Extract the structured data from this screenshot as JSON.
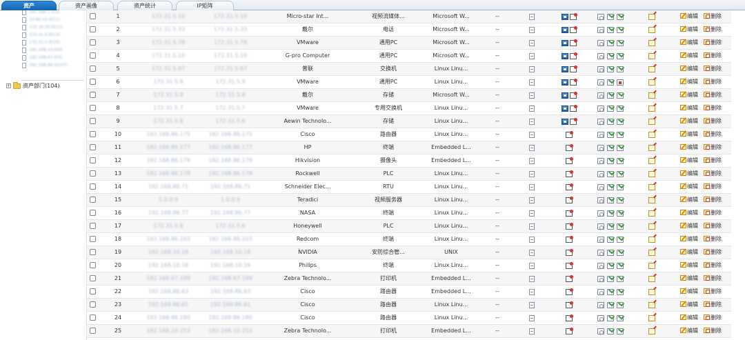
{
  "tabs": [
    {
      "label": "资产",
      "active": true
    },
    {
      "label": "资产画像",
      "active": false
    },
    {
      "label": "资产统计",
      "active": false
    },
    {
      "label": "IP矩阵",
      "active": false
    }
  ],
  "tree": {
    "children": [
      "192.168.1.0(1)",
      "10.90.10.0(11)",
      "172.16.20.0(11)",
      "172.21.0.0(13)",
      "172.21.5.0(10)",
      "192.168.10.0(9)",
      "192.168.67.0(3)",
      "192.168.86.0(107)"
    ],
    "root_label": "资产部门(104)"
  },
  "actions": {
    "edit": "编辑",
    "delete": "删除"
  },
  "rows": [
    {
      "num": "1",
      "ip1": "172.31.5.10",
      "ip2": "172.31.5.10",
      "vendor": "Micro-star Int...",
      "type": "视频流媒体...",
      "os": "Microsoft W...",
      "dash": "--",
      "mon": true
    },
    {
      "num": "2",
      "ip1": "172.31.5.33",
      "ip2": "172.31.5.33",
      "vendor": "戴尔",
      "type": "电话",
      "os": "Microsoft W...",
      "dash": "--",
      "mon": true
    },
    {
      "num": "3",
      "ip1": "172.31.5.78",
      "ip2": "172.31.5.78",
      "vendor": "VMware",
      "type": "通用PC",
      "os": "Microsoft W...",
      "dash": "--",
      "mon": true
    },
    {
      "num": "4",
      "ip1": "172.31.5.10",
      "ip2": "172.31.5.10",
      "vendor": "G-pro Computer",
      "type": "通用PC",
      "os": "Microsoft W...",
      "dash": "--",
      "mon": true
    },
    {
      "num": "5",
      "ip1": "172.31.5.87",
      "ip2": "172.31.5.87",
      "vendor": "普联",
      "type": "交换机",
      "os": "Linux Linu...",
      "dash": "--",
      "mon": true
    },
    {
      "num": "6",
      "ip1": "172.31.5.9",
      "ip2": "172.31.5.9",
      "vendor": "VMware",
      "type": "通用PC",
      "os": "Linux Linu...",
      "dash": "--",
      "mon": true,
      "red": true
    },
    {
      "num": "7",
      "ip1": "172.31.5.8",
      "ip2": "172.31.5.8",
      "vendor": "戴尔",
      "type": "存储",
      "os": "Microsoft W...",
      "dash": "--",
      "mon": true
    },
    {
      "num": "8",
      "ip1": "172.31.5.7",
      "ip2": "172.31.5.7",
      "vendor": "VMware",
      "type": "专用交换机",
      "os": "Linux Linu...",
      "dash": "--",
      "mon": true
    },
    {
      "num": "9",
      "ip1": "172.31.5.6",
      "ip2": "172.31.5.6",
      "vendor": "Aewin Technolo...",
      "type": "存储",
      "os": "Linux Linu...",
      "dash": "--",
      "mon": true
    },
    {
      "num": "10",
      "ip1": "192.168.86.175",
      "ip2": "192.168.86.175",
      "vendor": "Cisco",
      "type": "路由器",
      "os": "Linux Linu...",
      "dash": "--",
      "mon": false
    },
    {
      "num": "11",
      "ip1": "192.168.86.177",
      "ip2": "192.168.86.177",
      "vendor": "HP",
      "type": "终端",
      "os": "Embedded L...",
      "dash": "--",
      "mon": false
    },
    {
      "num": "12",
      "ip1": "192.168.86.179",
      "ip2": "192.168.86.179",
      "vendor": "Hikvision",
      "type": "摄像头",
      "os": "Embedded L...",
      "dash": "--",
      "mon": false
    },
    {
      "num": "13",
      "ip1": "192.168.86.178",
      "ip2": "192.168.86.178",
      "vendor": "Rockwell",
      "type": "PLC",
      "os": "Linux Linu...",
      "dash": "--",
      "mon": false
    },
    {
      "num": "14",
      "ip1": "192.168.86.71",
      "ip2": "192.168.86.71",
      "vendor": "Schneider Elec...",
      "type": "RTU",
      "os": "Linux Linu...",
      "dash": "--",
      "mon": false
    },
    {
      "num": "15",
      "ip1": "1.0.0.9",
      "ip2": "1.0.0.9",
      "vendor": "Teradici",
      "type": "视频服务器",
      "os": "Linux Linu...",
      "dash": "--",
      "mon": false
    },
    {
      "num": "16",
      "ip1": "192.168.86.77",
      "ip2": "192.168.86.77",
      "vendor": "NASA",
      "type": "终端",
      "os": "Linux Linu...",
      "dash": "--",
      "mon": false
    },
    {
      "num": "17",
      "ip1": "172.31.5.6",
      "ip2": "172.31.5.6",
      "vendor": "Honeywell",
      "type": "PLC",
      "os": "Linux Linu...",
      "dash": "--",
      "mon": false
    },
    {
      "num": "18",
      "ip1": "192.168.86.103",
      "ip2": "192.168.86.103",
      "vendor": "Redcom",
      "type": "终端",
      "os": "Linux Linu...",
      "dash": "--",
      "mon": false
    },
    {
      "num": "19",
      "ip1": "192.168.10.18",
      "ip2": "192.168.10.18",
      "vendor": "NVIDIA",
      "type": "安防综合管...",
      "os": "UNIX",
      "dash": "--",
      "mon": false
    },
    {
      "num": "20",
      "ip1": "192.168.10.16",
      "ip2": "192.168.10.16",
      "vendor": "Philips",
      "type": "终端",
      "os": "Linux Linu...",
      "dash": "--",
      "mon": false
    },
    {
      "num": "21",
      "ip1": "192.168.67.199",
      "ip2": "192.168.67.199",
      "vendor": "Zebra Technolo...",
      "type": "打印机",
      "os": "Embedded L...",
      "dash": "--",
      "mon": false
    },
    {
      "num": "22",
      "ip1": "192.168.86.63",
      "ip2": "192.168.86.63",
      "vendor": "Cisco",
      "type": "路由器",
      "os": "Embedded L...",
      "dash": "--",
      "mon": false
    },
    {
      "num": "23",
      "ip1": "192.168.86.61",
      "ip2": "192.168.86.61",
      "vendor": "Cisco",
      "type": "路由器",
      "os": "Linux Linu...",
      "dash": "--",
      "mon": false
    },
    {
      "num": "24",
      "ip1": "192.168.86.180",
      "ip2": "192.168.86.180",
      "vendor": "Cisco",
      "type": "路由器",
      "os": "Linux Linu...",
      "dash": "--",
      "mon": false
    },
    {
      "num": "25",
      "ip1": "192.168.10.253",
      "ip2": "192.168.10.253",
      "vendor": "Zebra Technolo...",
      "type": "打印机",
      "os": "Embedded L...",
      "dash": "--",
      "mon": false
    }
  ]
}
